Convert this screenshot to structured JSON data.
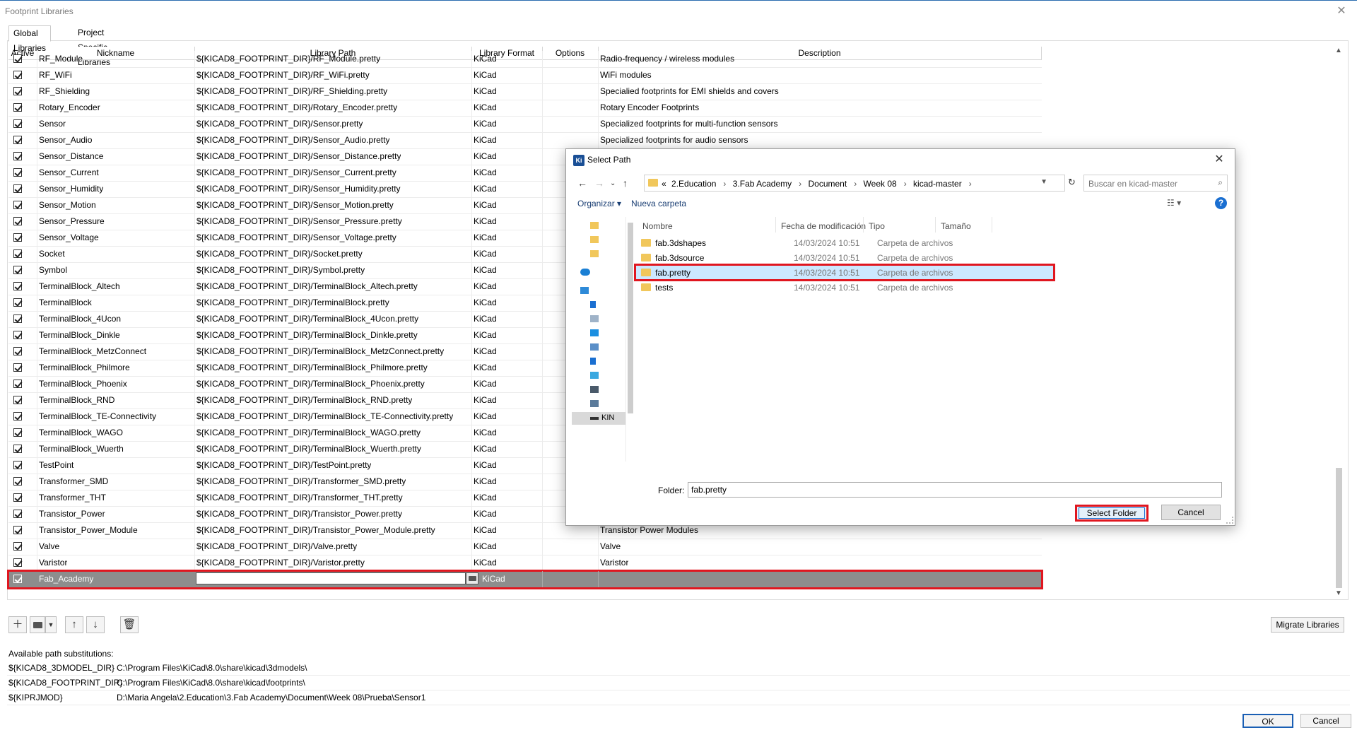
{
  "window": {
    "title": "Footprint Libraries"
  },
  "tabs": [
    {
      "label": "Global Libraries"
    },
    {
      "label": "Project Specific Libraries"
    }
  ],
  "grid": {
    "headers": {
      "active": "Active",
      "nickname": "Nickname",
      "path": "Library Path",
      "format": "Library Format",
      "options": "Options",
      "description": "Description"
    },
    "rows": [
      {
        "nickname": "RF_Module",
        "path": "${KICAD8_FOOTPRINT_DIR}/RF_Module.pretty",
        "format": "KiCad",
        "description": "Radio-frequency / wireless modules"
      },
      {
        "nickname": "RF_WiFi",
        "path": "${KICAD8_FOOTPRINT_DIR}/RF_WiFi.pretty",
        "format": "KiCad",
        "description": "WiFi modules"
      },
      {
        "nickname": "RF_Shielding",
        "path": "${KICAD8_FOOTPRINT_DIR}/RF_Shielding.pretty",
        "format": "KiCad",
        "description": "Specialied footprints for EMI shields and covers"
      },
      {
        "nickname": "Rotary_Encoder",
        "path": "${KICAD8_FOOTPRINT_DIR}/Rotary_Encoder.pretty",
        "format": "KiCad",
        "description": "Rotary Encoder Footprints"
      },
      {
        "nickname": "Sensor",
        "path": "${KICAD8_FOOTPRINT_DIR}/Sensor.pretty",
        "format": "KiCad",
        "description": "Specialized footprints for multi-function sensors"
      },
      {
        "nickname": "Sensor_Audio",
        "path": "${KICAD8_FOOTPRINT_DIR}/Sensor_Audio.pretty",
        "format": "KiCad",
        "description": "Specialized footprints for audio sensors"
      },
      {
        "nickname": "Sensor_Distance",
        "path": "${KICAD8_FOOTPRINT_DIR}/Sensor_Distance.pretty",
        "format": "KiCad",
        "description": ""
      },
      {
        "nickname": "Sensor_Current",
        "path": "${KICAD8_FOOTPRINT_DIR}/Sensor_Current.pretty",
        "format": "KiCad",
        "description": ""
      },
      {
        "nickname": "Sensor_Humidity",
        "path": "${KICAD8_FOOTPRINT_DIR}/Sensor_Humidity.pretty",
        "format": "KiCad",
        "description": ""
      },
      {
        "nickname": "Sensor_Motion",
        "path": "${KICAD8_FOOTPRINT_DIR}/Sensor_Motion.pretty",
        "format": "KiCad",
        "description": ""
      },
      {
        "nickname": "Sensor_Pressure",
        "path": "${KICAD8_FOOTPRINT_DIR}/Sensor_Pressure.pretty",
        "format": "KiCad",
        "description": ""
      },
      {
        "nickname": "Sensor_Voltage",
        "path": "${KICAD8_FOOTPRINT_DIR}/Sensor_Voltage.pretty",
        "format": "KiCad",
        "description": ""
      },
      {
        "nickname": "Socket",
        "path": "${KICAD8_FOOTPRINT_DIR}/Socket.pretty",
        "format": "KiCad",
        "description": ""
      },
      {
        "nickname": "Symbol",
        "path": "${KICAD8_FOOTPRINT_DIR}/Symbol.pretty",
        "format": "KiCad",
        "description": ""
      },
      {
        "nickname": "TerminalBlock_Altech",
        "path": "${KICAD8_FOOTPRINT_DIR}/TerminalBlock_Altech.pretty",
        "format": "KiCad",
        "description": ""
      },
      {
        "nickname": "TerminalBlock",
        "path": "${KICAD8_FOOTPRINT_DIR}/TerminalBlock.pretty",
        "format": "KiCad",
        "description": ""
      },
      {
        "nickname": "TerminalBlock_4Ucon",
        "path": "${KICAD8_FOOTPRINT_DIR}/TerminalBlock_4Ucon.pretty",
        "format": "KiCad",
        "description": ""
      },
      {
        "nickname": "TerminalBlock_Dinkle",
        "path": "${KICAD8_FOOTPRINT_DIR}/TerminalBlock_Dinkle.pretty",
        "format": "KiCad",
        "description": ""
      },
      {
        "nickname": "TerminalBlock_MetzConnect",
        "path": "${KICAD8_FOOTPRINT_DIR}/TerminalBlock_MetzConnect.pretty",
        "format": "KiCad",
        "description": ""
      },
      {
        "nickname": "TerminalBlock_Philmore",
        "path": "${KICAD8_FOOTPRINT_DIR}/TerminalBlock_Philmore.pretty",
        "format": "KiCad",
        "description": ""
      },
      {
        "nickname": "TerminalBlock_Phoenix",
        "path": "${KICAD8_FOOTPRINT_DIR}/TerminalBlock_Phoenix.pretty",
        "format": "KiCad",
        "description": ""
      },
      {
        "nickname": "TerminalBlock_RND",
        "path": "${KICAD8_FOOTPRINT_DIR}/TerminalBlock_RND.pretty",
        "format": "KiCad",
        "description": ""
      },
      {
        "nickname": "TerminalBlock_TE-Connectivity",
        "path": "${KICAD8_FOOTPRINT_DIR}/TerminalBlock_TE-Connectivity.pretty",
        "format": "KiCad",
        "description": ""
      },
      {
        "nickname": "TerminalBlock_WAGO",
        "path": "${KICAD8_FOOTPRINT_DIR}/TerminalBlock_WAGO.pretty",
        "format": "KiCad",
        "description": ""
      },
      {
        "nickname": "TerminalBlock_Wuerth",
        "path": "${KICAD8_FOOTPRINT_DIR}/TerminalBlock_Wuerth.pretty",
        "format": "KiCad",
        "description": ""
      },
      {
        "nickname": "TestPoint",
        "path": "${KICAD8_FOOTPRINT_DIR}/TestPoint.pretty",
        "format": "KiCad",
        "description": ""
      },
      {
        "nickname": "Transformer_SMD",
        "path": "${KICAD8_FOOTPRINT_DIR}/Transformer_SMD.pretty",
        "format": "KiCad",
        "description": ""
      },
      {
        "nickname": "Transformer_THT",
        "path": "${KICAD8_FOOTPRINT_DIR}/Transformer_THT.pretty",
        "format": "KiCad",
        "description": ""
      },
      {
        "nickname": "Transistor_Power",
        "path": "${KICAD8_FOOTPRINT_DIR}/Transistor_Power.pretty",
        "format": "KiCad",
        "description": ""
      },
      {
        "nickname": "Transistor_Power_Module",
        "path": "${KICAD8_FOOTPRINT_DIR}/Transistor_Power_Module.pretty",
        "format": "KiCad",
        "description": "Transistor Power Modules"
      },
      {
        "nickname": "Valve",
        "path": "${KICAD8_FOOTPRINT_DIR}/Valve.pretty",
        "format": "KiCad",
        "description": "Valve"
      },
      {
        "nickname": "Varistor",
        "path": "${KICAD8_FOOTPRINT_DIR}/Varistor.pretty",
        "format": "KiCad",
        "description": "Varistor"
      }
    ],
    "new_row": {
      "nickname": "Fab_Academy",
      "path": "",
      "format": "KiCad",
      "description": ""
    }
  },
  "toolbar": {
    "icons": [
      "add-icon",
      "folder-icon",
      "dropdown-arrow-icon",
      "move-up-icon",
      "move-down-icon",
      "trash-icon"
    ],
    "migrate_label": "Migrate Libraries"
  },
  "substitutions": {
    "label": "Available path substitutions:",
    "rows": [
      {
        "key": "${KICAD8_3DMODEL_DIR}",
        "value": "C:\\Program Files\\KiCad\\8.0\\share\\kicad\\3dmodels\\"
      },
      {
        "key": "${KICAD8_FOOTPRINT_DIR}",
        "value": "C:\\Program Files\\KiCad\\8.0\\share\\kicad\\footprints\\"
      },
      {
        "key": "${KIPRJMOD}",
        "value": "D:\\Maria Angela\\2.Education\\3.Fab Academy\\Document\\Week 08\\Prueba\\Sensor1"
      }
    ]
  },
  "footer": {
    "ok": "OK",
    "cancel": "Cancel"
  },
  "dialog": {
    "title": "Select Path",
    "app_icon_text": "Ki",
    "breadcrumbs": [
      "«",
      "2.Education",
      "3.Fab Academy",
      "Document",
      "Week 08",
      "kicad-master"
    ],
    "search_placeholder": "Buscar en kicad-master",
    "organize": "Organizar ▾",
    "new_folder": "Nueva carpeta",
    "columns": {
      "name": "Nombre",
      "date": "Fecha de modificación",
      "type": "Tipo",
      "size": "Tamaño"
    },
    "files": [
      {
        "name": "fab.3dshapes",
        "date": "14/03/2024 10:51",
        "type": "Carpeta de archivos"
      },
      {
        "name": "fab.3dsource",
        "date": "14/03/2024 10:51",
        "type": "Carpeta de archivos"
      },
      {
        "name": "fab.pretty",
        "date": "14/03/2024 10:51",
        "type": "Carpeta de archivos"
      },
      {
        "name": "tests",
        "date": "14/03/2024 10:51",
        "type": "Carpeta de archivos"
      }
    ],
    "nav_drive_label": "KIN",
    "folder_label": "Folder:",
    "folder_value": "fab.pretty",
    "select_folder": "Select Folder",
    "cancel": "Cancel"
  },
  "colors": {
    "selection_gray": "#8d8d8d",
    "highlight_red": "#e0161f",
    "selected_blue": "#cce8ff",
    "folder_yellow": "#f1c75b"
  }
}
